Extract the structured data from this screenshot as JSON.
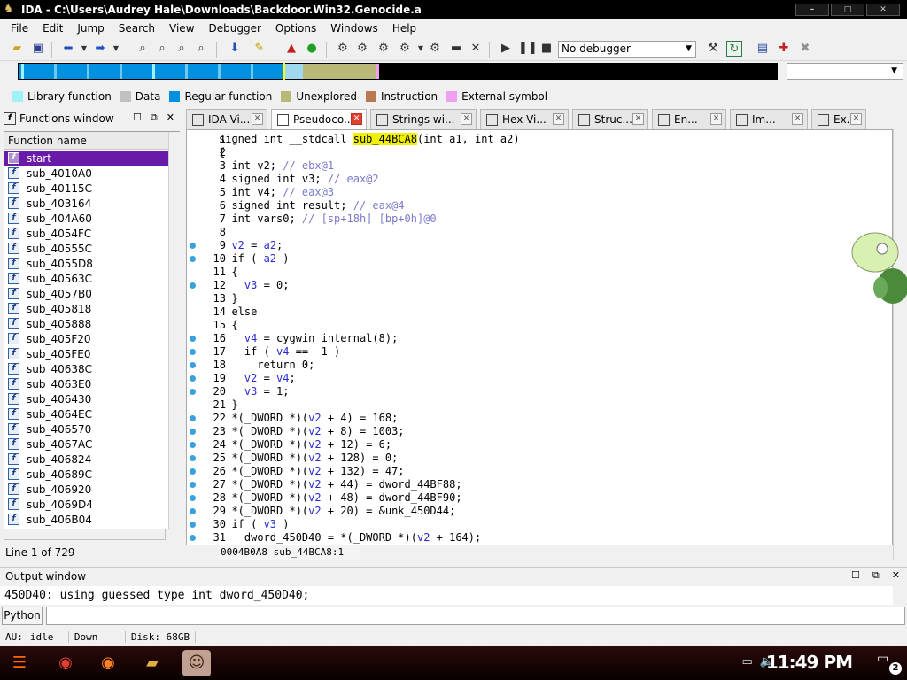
{
  "window": {
    "title": "IDA - C:\\Users\\Audrey Hale\\Downloads\\Backdoor.Win32.Genocide.a",
    "controls": [
      "–",
      "□",
      "✕"
    ]
  },
  "menu": [
    "File",
    "Edit",
    "Jump",
    "Search",
    "View",
    "Debugger",
    "Options",
    "Windows",
    "Help"
  ],
  "toolbar": {
    "debugger_select": "No debugger"
  },
  "legend": [
    {
      "label": "Library function",
      "color": "#a0f0f8"
    },
    {
      "label": "Data",
      "color": "#c0c0c0"
    },
    {
      "label": "Regular function",
      "color": "#0090e0"
    },
    {
      "label": "Unexplored",
      "color": "#b8b878"
    },
    {
      "label": "Instruction",
      "color": "#b87850"
    },
    {
      "label": "External symbol",
      "color": "#f0a0f0"
    }
  ],
  "functions_window": {
    "title": "Functions window",
    "column": "Function name",
    "items": [
      "start",
      "sub_4010A0",
      "sub_40115C",
      "sub_403164",
      "sub_404A60",
      "sub_4054FC",
      "sub_40555C",
      "sub_4055D8",
      "sub_40563C",
      "sub_4057B0",
      "sub_405818",
      "sub_405888",
      "sub_405F20",
      "sub_405FE0",
      "sub_40638C",
      "sub_4063E0",
      "sub_406430",
      "sub_4064EC",
      "sub_406570",
      "sub_4067AC",
      "sub_406824",
      "sub_40689C",
      "sub_406920",
      "sub_4069D4",
      "sub_406B04"
    ],
    "status": "Line 1 of 729"
  },
  "tabs": [
    {
      "label": "IDA Vi...",
      "icon": "ida-view-icon"
    },
    {
      "label": "Pseudoco...",
      "icon": "pseudocode-icon",
      "active": true
    },
    {
      "label": "Strings wi...",
      "icon": "strings-icon"
    },
    {
      "label": "Hex Vi...",
      "icon": "hex-view-icon"
    },
    {
      "label": "Struc...",
      "icon": "structures-icon"
    },
    {
      "label": "En...",
      "icon": "enums-icon"
    },
    {
      "label": "Im...",
      "icon": "imports-icon"
    },
    {
      "label": "Ex...",
      "icon": "exports-icon"
    }
  ],
  "code": {
    "footer": "0004B0A8 sub_44BCA8:1",
    "lines": [
      {
        "n": "1",
        "dot": false,
        "parts": [
          [
            "kw",
            "signed int __stdcall "
          ],
          [
            "hl",
            "sub_44BCA8"
          ],
          [
            "kw",
            "(int a1, int a2)"
          ]
        ]
      },
      {
        "n": "2",
        "dot": false,
        "parts": [
          [
            "kw",
            "{"
          ]
        ]
      },
      {
        "n": "3",
        "dot": false,
        "parts": [
          [
            "kw",
            "  int v2; "
          ],
          [
            "cmt",
            "// ebx@1"
          ]
        ]
      },
      {
        "n": "4",
        "dot": false,
        "parts": [
          [
            "kw",
            "  signed int v3; "
          ],
          [
            "cmt",
            "// eax@2"
          ]
        ]
      },
      {
        "n": "5",
        "dot": false,
        "parts": [
          [
            "kw",
            "  int v4; "
          ],
          [
            "cmt",
            "// eax@3"
          ]
        ]
      },
      {
        "n": "6",
        "dot": false,
        "parts": [
          [
            "kw",
            "  signed int result; "
          ],
          [
            "cmt",
            "// eax@4"
          ]
        ]
      },
      {
        "n": "7",
        "dot": false,
        "parts": [
          [
            "kw",
            "  int vars0; "
          ],
          [
            "cmt",
            "// [sp+18h] [bp+0h]@0"
          ]
        ]
      },
      {
        "n": "8",
        "dot": false,
        "parts": [
          [
            "kw",
            ""
          ]
        ]
      },
      {
        "n": "9",
        "dot": true,
        "parts": [
          [
            "kw",
            "  "
          ],
          [
            "var",
            "v2"
          ],
          [
            "kw",
            " = "
          ],
          [
            "var",
            "a2"
          ],
          [
            "kw",
            ";"
          ]
        ]
      },
      {
        "n": "10",
        "dot": true,
        "parts": [
          [
            "kw",
            "  if ( "
          ],
          [
            "var",
            "a2"
          ],
          [
            "kw",
            " )"
          ]
        ]
      },
      {
        "n": "11",
        "dot": false,
        "parts": [
          [
            "kw",
            "  {"
          ]
        ]
      },
      {
        "n": "12",
        "dot": true,
        "parts": [
          [
            "kw",
            "    "
          ],
          [
            "var",
            "v3"
          ],
          [
            "kw",
            " = 0;"
          ]
        ]
      },
      {
        "n": "13",
        "dot": false,
        "parts": [
          [
            "kw",
            "  }"
          ]
        ]
      },
      {
        "n": "14",
        "dot": false,
        "parts": [
          [
            "kw",
            "  else"
          ]
        ]
      },
      {
        "n": "15",
        "dot": false,
        "parts": [
          [
            "kw",
            "  {"
          ]
        ]
      },
      {
        "n": "16",
        "dot": true,
        "parts": [
          [
            "kw",
            "    "
          ],
          [
            "var",
            "v4"
          ],
          [
            "kw",
            " = cygwin_internal(8);"
          ]
        ]
      },
      {
        "n": "17",
        "dot": true,
        "parts": [
          [
            "kw",
            "    if ( "
          ],
          [
            "var",
            "v4"
          ],
          [
            "kw",
            " == -1 )"
          ]
        ]
      },
      {
        "n": "18",
        "dot": true,
        "parts": [
          [
            "kw",
            "      return 0;"
          ]
        ]
      },
      {
        "n": "19",
        "dot": true,
        "parts": [
          [
            "kw",
            "    "
          ],
          [
            "var",
            "v2"
          ],
          [
            "kw",
            " = "
          ],
          [
            "var",
            "v4"
          ],
          [
            "kw",
            ";"
          ]
        ]
      },
      {
        "n": "20",
        "dot": true,
        "parts": [
          [
            "kw",
            "    "
          ],
          [
            "var",
            "v3"
          ],
          [
            "kw",
            " = 1;"
          ]
        ]
      },
      {
        "n": "21",
        "dot": false,
        "parts": [
          [
            "kw",
            "  }"
          ]
        ]
      },
      {
        "n": "22",
        "dot": true,
        "parts": [
          [
            "kw",
            "  *(_DWORD *)("
          ],
          [
            "var",
            "v2"
          ],
          [
            "kw",
            " + 4) = 168;"
          ]
        ]
      },
      {
        "n": "23",
        "dot": true,
        "parts": [
          [
            "kw",
            "  *(_DWORD *)("
          ],
          [
            "var",
            "v2"
          ],
          [
            "kw",
            " + 8) = 1003;"
          ]
        ]
      },
      {
        "n": "24",
        "dot": true,
        "parts": [
          [
            "kw",
            "  *(_DWORD *)("
          ],
          [
            "var",
            "v2"
          ],
          [
            "kw",
            " + 12) = 6;"
          ]
        ]
      },
      {
        "n": "25",
        "dot": true,
        "parts": [
          [
            "kw",
            "  *(_DWORD *)("
          ],
          [
            "var",
            "v2"
          ],
          [
            "kw",
            " + 128) = 0;"
          ]
        ]
      },
      {
        "n": "26",
        "dot": true,
        "parts": [
          [
            "kw",
            "  *(_DWORD *)("
          ],
          [
            "var",
            "v2"
          ],
          [
            "kw",
            " + 132) = 47;"
          ]
        ]
      },
      {
        "n": "27",
        "dot": true,
        "parts": [
          [
            "kw",
            "  *(_DWORD *)("
          ],
          [
            "var",
            "v2"
          ],
          [
            "kw",
            " + 44) = dword_44BF88;"
          ]
        ]
      },
      {
        "n": "28",
        "dot": true,
        "parts": [
          [
            "kw",
            "  *(_DWORD *)("
          ],
          [
            "var",
            "v2"
          ],
          [
            "kw",
            " + 48) = dword_44BF90;"
          ]
        ]
      },
      {
        "n": "29",
        "dot": true,
        "parts": [
          [
            "kw",
            "  *(_DWORD *)("
          ],
          [
            "var",
            "v2"
          ],
          [
            "kw",
            " + 20) = &unk_450D44;"
          ]
        ]
      },
      {
        "n": "30",
        "dot": true,
        "parts": [
          [
            "kw",
            "  if ( "
          ],
          [
            "var",
            "v3"
          ],
          [
            "kw",
            " )"
          ]
        ]
      },
      {
        "n": "31",
        "dot": true,
        "parts": [
          [
            "kw",
            "    dword_450D40 = *(_DWORD *)("
          ],
          [
            "var",
            "v2"
          ],
          [
            "kw",
            " + 164);"
          ]
        ]
      }
    ]
  },
  "output": {
    "title": "Output window",
    "text": "450D40: using guessed type int dword_450D40;",
    "python_label": "Python"
  },
  "status": {
    "au": "AU:",
    "state": "idle",
    "direction": "Down",
    "disk": "Disk: 68GB"
  },
  "taskbar": {
    "clock": "11:49 PM",
    "notifications": "2"
  }
}
